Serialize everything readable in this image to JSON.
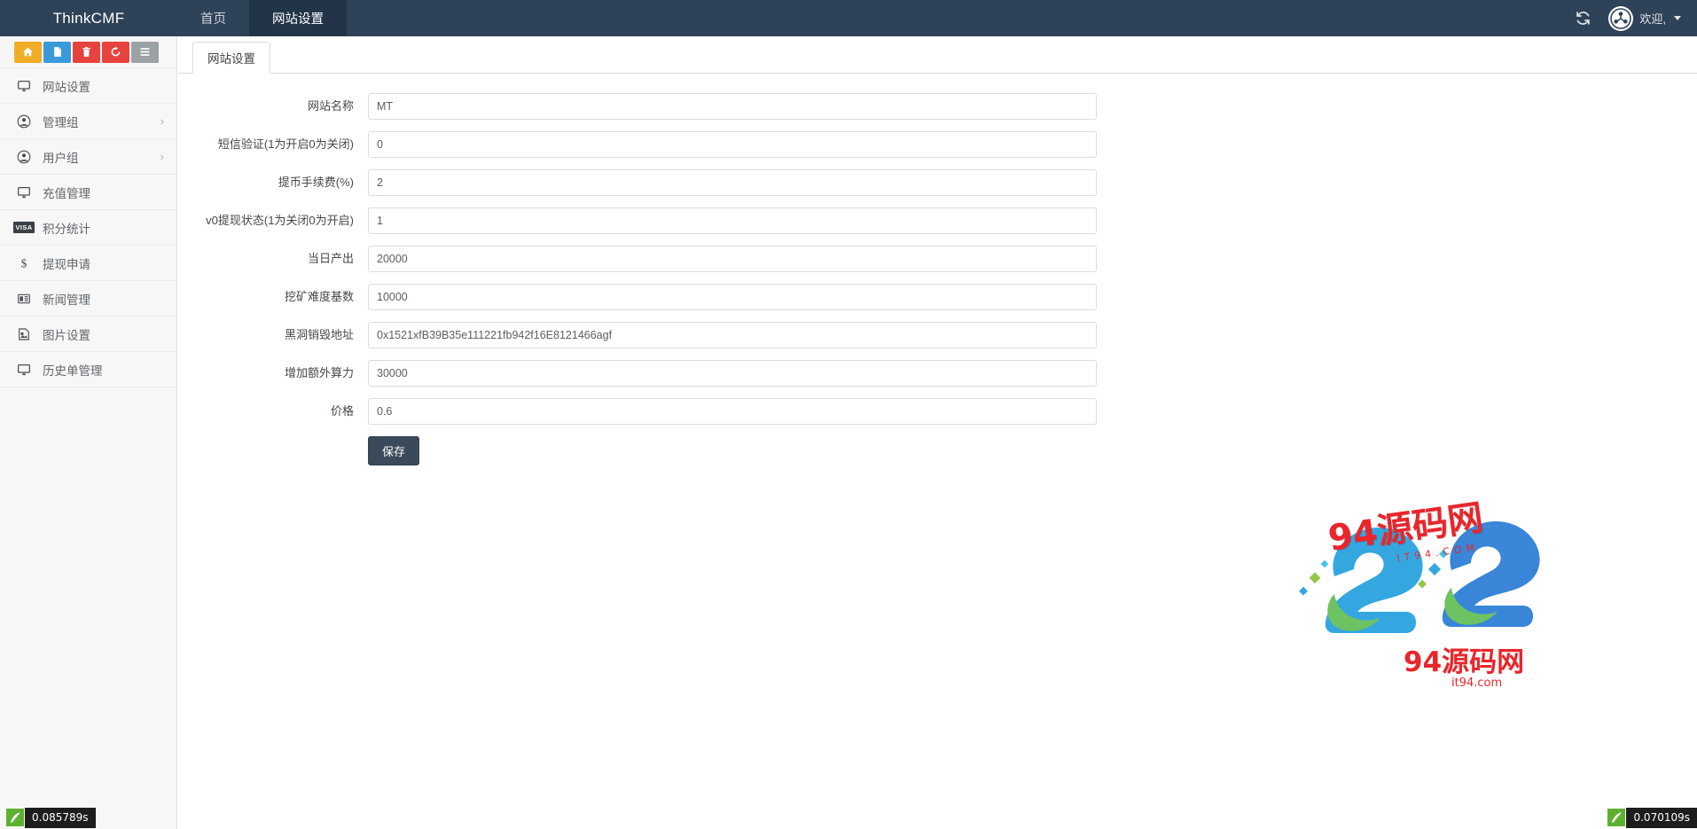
{
  "navbar": {
    "brand": "ThinkCMF",
    "items": [
      {
        "label": "首页",
        "active": false
      },
      {
        "label": "网站设置",
        "active": true
      }
    ],
    "refresh_icon": "refresh-icon",
    "avatar_icon": "user-avatar-icon",
    "welcome": "欢迎,",
    "caret_icon": "caret-down-icon"
  },
  "sidebar": {
    "toolbar": [
      {
        "name": "home-tool-button",
        "icon": "home-icon",
        "color": "#f0ad27"
      },
      {
        "name": "file-tool-button",
        "icon": "file-icon",
        "color": "#3a9ad9"
      },
      {
        "name": "trash-tool-button",
        "icon": "trash-icon",
        "color": "#e8423f"
      },
      {
        "name": "refresh-tool-button",
        "icon": "refresh-icon",
        "color": "#e8423f"
      },
      {
        "name": "list-tool-button",
        "icon": "list-icon",
        "color": "#9aa2a6"
      }
    ],
    "items": [
      {
        "label": "网站设置",
        "icon": "monitor-icon",
        "chevron": ""
      },
      {
        "label": "管理组",
        "icon": "user-circle-icon",
        "chevron": "›"
      },
      {
        "label": "用户组",
        "icon": "user-circle-icon",
        "chevron": "›"
      },
      {
        "label": "充值管理",
        "icon": "monitor-icon",
        "chevron": ""
      },
      {
        "label": "积分统计",
        "icon": "visa-icon",
        "chevron": ""
      },
      {
        "label": "提现申请",
        "icon": "dollar-icon",
        "chevron": ""
      },
      {
        "label": "新闻管理",
        "icon": "news-icon",
        "chevron": ""
      },
      {
        "label": "图片设置",
        "icon": "image-icon",
        "chevron": ""
      },
      {
        "label": "历史单管理",
        "icon": "monitor-icon",
        "chevron": ""
      }
    ]
  },
  "main": {
    "tab_label": "网站设置",
    "fields": [
      {
        "label": "网站名称",
        "value": "MT",
        "placeholder": ""
      },
      {
        "label": "短信验证(1为开启0为关闭)",
        "value": "0",
        "placeholder": ""
      },
      {
        "label": "提币手续费(%)",
        "value": "2",
        "placeholder": ""
      },
      {
        "label": "v0提现状态(1为关闭0为开启)",
        "value": "1",
        "placeholder": ""
      },
      {
        "label": "当日产出",
        "value": "20000",
        "placeholder": ""
      },
      {
        "label": "挖矿难度基数",
        "value": "10000",
        "placeholder": ""
      },
      {
        "label": "黑洞销毁地址",
        "value": "0x1521xfB39B35e111221fb942f16E8121466agf",
        "placeholder": ""
      },
      {
        "label": "增加额外算力",
        "value": "30000",
        "placeholder": ""
      },
      {
        "label": "价格",
        "value": "0.6",
        "placeholder": ""
      }
    ],
    "save_label": "保存"
  },
  "watermark": {
    "title_top": "94源码网",
    "sub": "IT94.COM",
    "title_bottom": "94源码网",
    "domain": "it94.com"
  },
  "debug": {
    "left_time": "0.085789s",
    "right_time": "0.070109s"
  },
  "colors": {
    "navbar_bg": "#2e4258",
    "nav_active_bg": "#223548",
    "sidebar_bg": "#f7f7f7",
    "save_btn_bg": "#3b4a5a",
    "watermark_red": "#e8262b"
  }
}
